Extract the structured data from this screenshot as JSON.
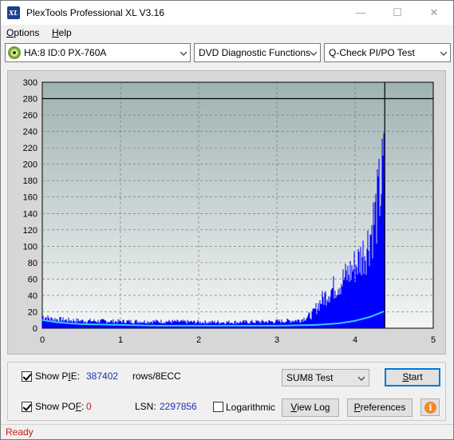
{
  "window": {
    "title": "PlexTools Professional XL V3.16",
    "app_icon_text": "XL",
    "minimize_glyph": "—",
    "maximize_glyph": "☐",
    "close_glyph": "✕"
  },
  "menu": {
    "options": {
      "accel": "O",
      "rest": "ptions"
    },
    "help": {
      "accel": "H",
      "rest": "elp"
    }
  },
  "toolbar": {
    "drive": "HA:8 ID:0  PX-760A",
    "function": "DVD Diagnostic Functions",
    "test": "Q-Check PI/PO Test"
  },
  "chart_data": {
    "type": "area",
    "title": "",
    "xlabel": "",
    "ylabel": "",
    "xlim": [
      0,
      5
    ],
    "ylim": [
      0,
      300
    ],
    "x_ticks": [
      "0",
      "1",
      "2",
      "3",
      "4",
      "5"
    ],
    "y_ticks": [
      "0",
      "20",
      "40",
      "60",
      "80",
      "100",
      "120",
      "140",
      "160",
      "180",
      "200",
      "220",
      "240",
      "260",
      "280",
      "300"
    ],
    "grid": true,
    "limit_line": 280,
    "end_marker_x": 4.38,
    "series": [
      {
        "kind": "PI errors (bars)",
        "color": "#0000ff",
        "x": [
          0.0,
          0.1,
          0.3,
          0.5,
          1.0,
          1.5,
          2.0,
          2.5,
          3.0,
          3.3,
          3.45,
          3.55,
          3.65,
          3.75,
          3.85,
          3.95,
          4.05,
          4.15,
          4.22,
          4.28,
          4.32,
          4.36,
          4.38
        ],
        "y": [
          18,
          14,
          12,
          11,
          10,
          10,
          9,
          9,
          10,
          12,
          20,
          38,
          52,
          62,
          72,
          85,
          100,
          120,
          150,
          175,
          205,
          228,
          238
        ]
      },
      {
        "kind": "PI 8 sum (line)",
        "color": "#33ccff",
        "x": [
          0.0,
          0.2,
          0.5,
          1.0,
          1.5,
          2.0,
          2.5,
          3.0,
          3.5,
          3.8,
          4.0,
          4.2,
          4.38
        ],
        "y": [
          10,
          7,
          5,
          4,
          3,
          3,
          3,
          3,
          4,
          6,
          9,
          14,
          21
        ]
      }
    ]
  },
  "bottom": {
    "show_pie_prefix": "Show P",
    "show_pie_accel": "I",
    "show_pie_suffix": "E:",
    "pie_value": "387402",
    "pie_unit": "rows/8ECC",
    "show_pof_prefix": "Show PO",
    "show_pof_accel": "F",
    "show_pof_suffix": ":",
    "pof_value": "0",
    "lsn_label": "LSN:",
    "lsn_value": "2297856",
    "logarithmic": "Logarithmic",
    "sum_select": "SUM8 Test",
    "start": {
      "accel": "S",
      "rest": "tart"
    },
    "view_log": {
      "accel": "V",
      "rest": "iew Log"
    },
    "preferences": {
      "accel": "P",
      "rest": "references"
    },
    "info_glyph": "i"
  },
  "status": {
    "text": "Ready"
  }
}
